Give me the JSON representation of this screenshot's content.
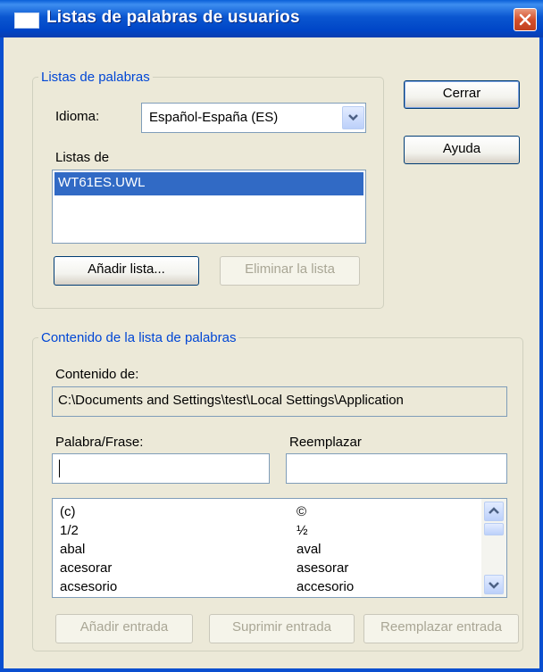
{
  "window": {
    "title": "Listas de palabras de usuarios"
  },
  "buttons": {
    "close": "Cerrar",
    "help": "Ayuda"
  },
  "wordlists_group": {
    "legend": "Listas de palabras",
    "language_label": "Idioma:",
    "language_value": "Español-España (ES)",
    "lists_label": "Listas de",
    "lists": [
      "WT61ES.UWL"
    ],
    "add_list": "Añadir lista...",
    "remove_list": "Eliminar la lista"
  },
  "content_group": {
    "legend": "Contenido de la lista de palabras",
    "content_of_label": "Contenido de:",
    "content_path": "C:\\Documents and Settings\\test\\Local Settings\\Application",
    "word_label": "Palabra/Frase:",
    "word_value": "",
    "replace_label": "Reemplazar",
    "replace_value": "",
    "entries": [
      {
        "word": "(c)",
        "replacement": "©"
      },
      {
        "word": "1/2",
        "replacement": "½"
      },
      {
        "word": "abal",
        "replacement": "aval"
      },
      {
        "word": "acesorar",
        "replacement": "asesorar"
      },
      {
        "word": "acsesorio",
        "replacement": "accesorio"
      }
    ],
    "add_entry": "Añadir entrada",
    "delete_entry": "Suprimir entrada",
    "replace_entry": "Reemplazar entrada"
  }
}
